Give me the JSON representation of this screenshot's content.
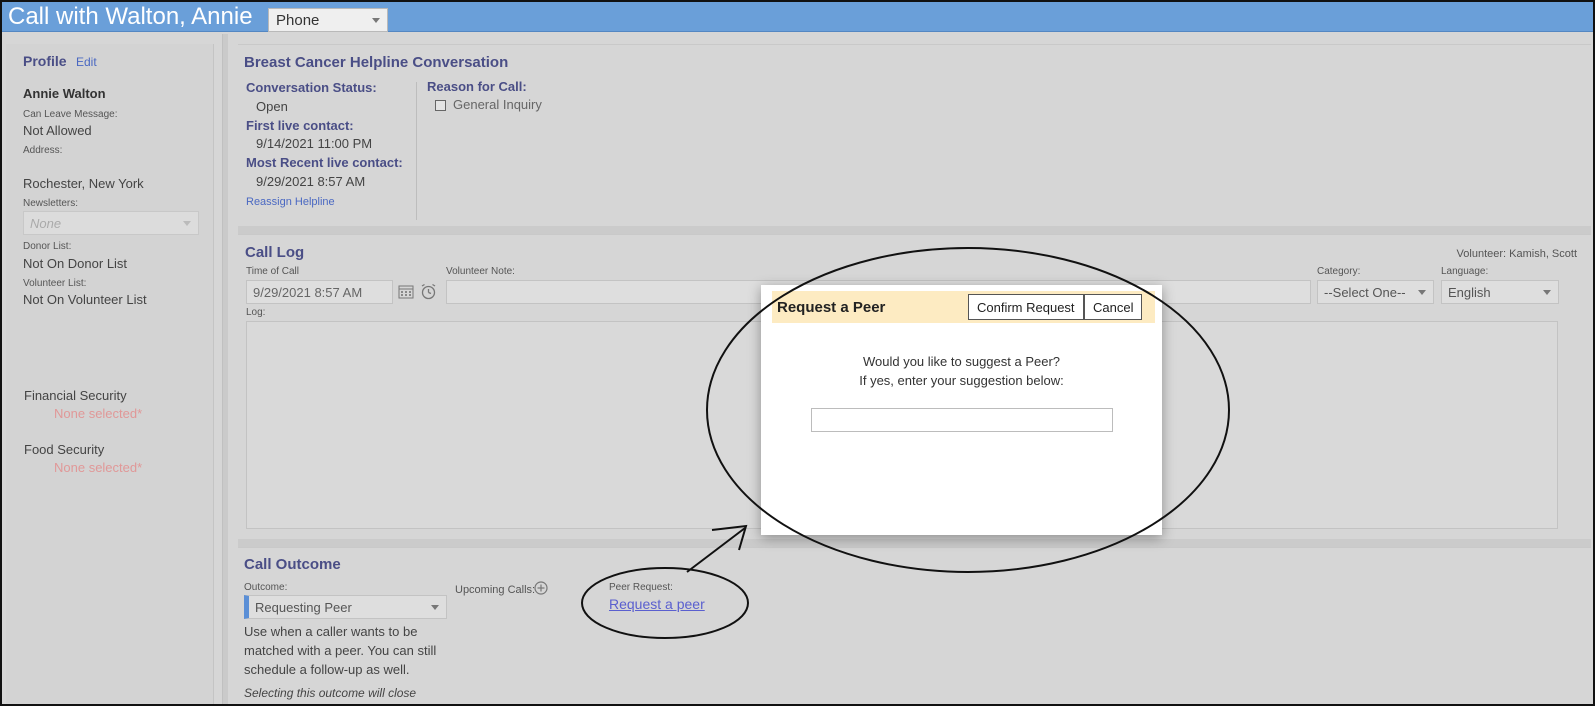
{
  "window": {
    "title": "Call with Walton, Annie",
    "channel": "Phone"
  },
  "sidebar": {
    "profile_heading": "Profile",
    "edit_link": "Edit",
    "name": "Annie Walton",
    "can_leave_message_label": "Can Leave Message:",
    "can_leave_message": "Not Allowed",
    "address_label": "Address:",
    "address": "Rochester, New York",
    "newsletters_label": "Newsletters:",
    "newsletters": "None",
    "donor_list_label": "Donor List:",
    "donor_list": "Not On Donor List",
    "volunteer_list_label": "Volunteer List:",
    "volunteer_list": "Not On Volunteer List",
    "financial_security_label": "Financial Security",
    "financial_security": "None selected*",
    "food_security_label": "Food Security",
    "food_security": "None selected*"
  },
  "conversation": {
    "title": "Breast Cancer Helpline Conversation",
    "status_label": "Conversation Status:",
    "status": "Open",
    "first_contact_label": "First live contact:",
    "first_contact": "9/14/2021 11:00 PM",
    "recent_contact_label": "Most Recent live contact:",
    "recent_contact": "9/29/2021 8:57 AM",
    "reassign_link": "Reassign Helpline",
    "reason_label": "Reason for Call:",
    "reason_option": "General Inquiry"
  },
  "call_log": {
    "title": "Call Log",
    "volunteer": "Volunteer:  Kamish, Scott",
    "time_label": "Time of Call",
    "time_value": "9/29/2021 8:57 AM",
    "note_label": "Volunteer Note:",
    "category_label": "Category:",
    "category_value": "--Select One--",
    "language_label": "Language:",
    "language_value": "English",
    "log_label": "Log:"
  },
  "call_outcome": {
    "title": "Call Outcome",
    "outcome_label": "Outcome:",
    "outcome_value": "Requesting Peer",
    "description": [
      "Use when a caller wants to be",
      "matched with a peer. You can still",
      "schedule a follow-up as well."
    ],
    "note": "Selecting this outcome will close",
    "upcoming_label": "Upcoming Calls:",
    "peer_request_label": "Peer Request:",
    "peer_request_link": "Request a peer"
  },
  "modal": {
    "title": "Request a Peer",
    "confirm_label": "Confirm Request",
    "cancel_label": "Cancel",
    "message_line1": "Would you like to suggest a Peer?",
    "message_line2": "If yes, enter your suggestion below:",
    "input_value": ""
  },
  "colors": {
    "title_bar": "#6a9fd9",
    "heading": "#4a4e86",
    "link": "#4a68c2",
    "placeholder_red": "#e09898",
    "modal_header": "#fdebc2",
    "outcome_accent": "#5b8fd6"
  }
}
